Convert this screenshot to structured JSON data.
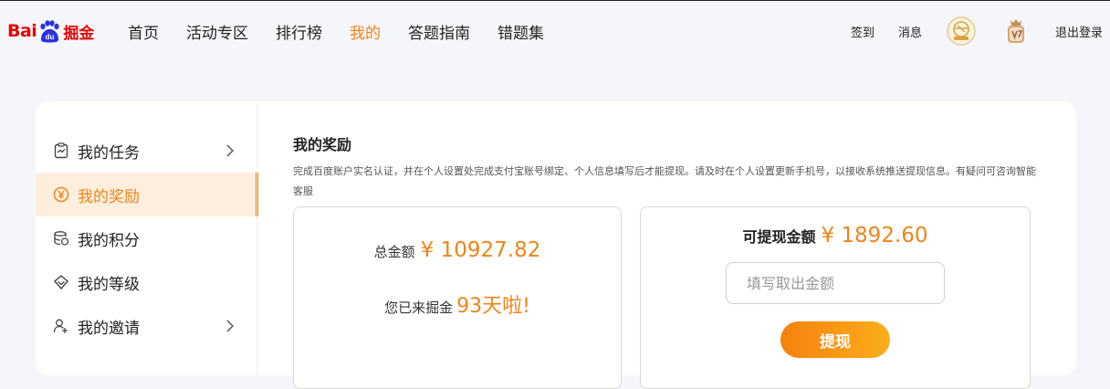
{
  "header": {
    "logo": {
      "text_left": "Bai",
      "text_paw": "du",
      "text_right": "掘金",
      "color": "#e10602"
    },
    "nav": [
      {
        "label": "首页",
        "active": false
      },
      {
        "label": "活动专区",
        "active": false
      },
      {
        "label": "排行榜",
        "active": false
      },
      {
        "label": "我的",
        "active": true
      },
      {
        "label": "答题指南",
        "active": false
      },
      {
        "label": "错题集",
        "active": false
      }
    ],
    "right": {
      "checkin": "签到",
      "messages": "消息",
      "badge1_icon": "medal-badge-icon",
      "badge2_icon": "v7-level-badge-icon",
      "logout": "退出登录"
    }
  },
  "sidebar": {
    "items": [
      {
        "label": "我的任务",
        "icon": "task-clipboard-icon",
        "active": false,
        "has_chevron": true
      },
      {
        "label": "我的奖励",
        "icon": "yen-coin-icon",
        "active": true,
        "has_chevron": false
      },
      {
        "label": "我的积分",
        "icon": "coin-stack-icon",
        "active": false,
        "has_chevron": false
      },
      {
        "label": "我的等级",
        "icon": "diamond-level-icon",
        "active": false,
        "has_chevron": false
      },
      {
        "label": "我的邀请",
        "icon": "invite-user-icon",
        "active": false,
        "has_chevron": true
      }
    ]
  },
  "rewards": {
    "title": "我的奖励",
    "description": "完成百度账户实名认证，并在个人设置处完成支付宝账号绑定、个人信息填写后才能提现。请及时在个人设置更新手机号，以接收系统推送提现信息。有疑问可咨询智能客服",
    "total_label": "总金额",
    "total_amount": "¥ 10927.82",
    "days_label": "您已来掘金",
    "days_value": "93天啦!",
    "withdrawable_label": "可提现金额",
    "withdrawable_amount": "¥ 1892.60",
    "input_placeholder": "填写取出金额",
    "withdraw_button": "提现"
  },
  "colors": {
    "accent": "#f08418",
    "brand_red": "#e10602",
    "active_bg": "#fdeedd",
    "page_bg": "#f5f6fa"
  }
}
